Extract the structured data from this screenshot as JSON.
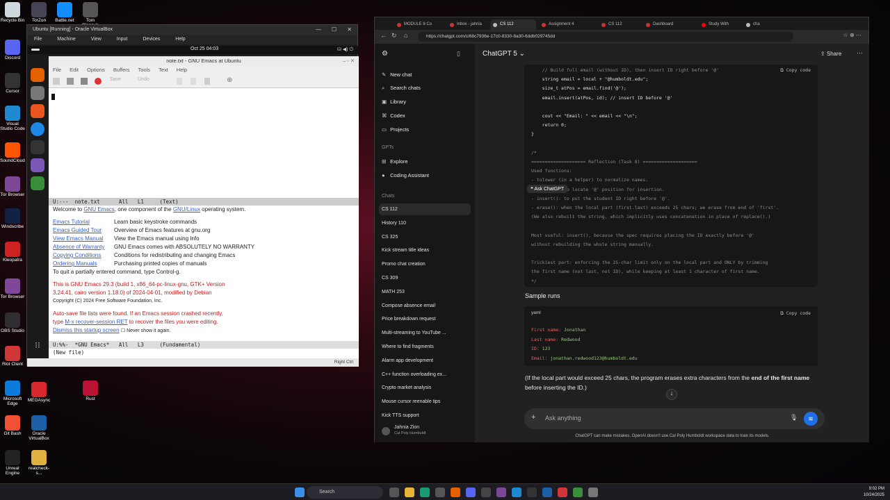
{
  "desktop_icons": [
    {
      "label": "Recycle Bin",
      "color": "#cfd8dc"
    },
    {
      "label": "Discord",
      "color": "#5865f2"
    },
    {
      "label": "Cursor",
      "color": "#333"
    },
    {
      "label": "Visual Studio Code",
      "color": "#1f8ad2"
    },
    {
      "label": "SoundCloud",
      "color": "#ff5500"
    },
    {
      "label": "Tor Browser",
      "color": "#7e4798"
    },
    {
      "label": "Windscribe",
      "color": "#124"
    },
    {
      "label": "Kleopatra",
      "color": "#c22"
    },
    {
      "label": "Tor Browser",
      "color": "#7e4798"
    },
    {
      "label": "OBS Studio",
      "color": "#302e31"
    },
    {
      "label": "Riot Client",
      "color": "#d13639"
    },
    {
      "label": "Microsoft Edge",
      "color": "#0c7bdc"
    },
    {
      "label": "Git Bash",
      "color": "#f05033"
    },
    {
      "label": "Unreal Engine",
      "color": "#222"
    }
  ],
  "desktop_icons2": [
    {
      "label": "TorZon",
      "color": "#445"
    },
    {
      "label": "Battle.net",
      "color": "#148eff"
    },
    {
      "label": "Tom Clancy's",
      "color": "#555"
    },
    {
      "label": "MEGAsync",
      "color": "#d9272e"
    },
    {
      "label": "Oracle VirtualBox",
      "color": "#1d5fa5"
    },
    {
      "label": "realcheck-s...",
      "color": "#e0b040"
    },
    {
      "label": "Rust",
      "color": "#b13"
    }
  ],
  "vbox": {
    "title": "Ubuntu [Running] - Oracle VirtualBox",
    "menu": [
      "File",
      "Machine",
      "View",
      "Input",
      "Devices",
      "Help"
    ],
    "clock": "Oct 25  04:03",
    "status": "Right Ctrl"
  },
  "emacs": {
    "title": "note.txt - GNU Emacs at Ubuntu",
    "menu": [
      "File",
      "Edit",
      "Options",
      "Buffers",
      "Tools",
      "Text",
      "Help"
    ],
    "tool_save": "Save",
    "tool_undo": "Undo",
    "modeline1": "U:---  note.txt      All   L1     (Text)",
    "welcome_pre": "Welcome to ",
    "welcome_link1": "GNU Emacs",
    "welcome_mid": ", one component of the ",
    "welcome_link2": "GNU/Linux",
    "welcome_post": " operating system.",
    "rows": [
      {
        "link": "Emacs Tutorial",
        "text": "Learn basic keystroke commands"
      },
      {
        "link": "Emacs Guided Tour",
        "text": "Overview of Emacs features at gnu.org"
      },
      {
        "link": "View Emacs Manual",
        "text": "View the Emacs manual using Info"
      },
      {
        "link": "Absence of Warranty",
        "text": "GNU Emacs comes with ABSOLUTELY NO WARRANTY"
      },
      {
        "link": "Copying Conditions",
        "text": "Conditions for redistributing and changing Emacs"
      },
      {
        "link": "Ordering Manuals",
        "text": "Purchasing printed copies of manuals"
      }
    ],
    "quit": "To quit a partially entered command, type Control-g.",
    "version1": "This is GNU Emacs 29.3 (build 1, x86_64-pc-linux-gnu, GTK+ Version",
    "version2": " 3.24.41, cairo version 1.18.0) of 2024-04-01, modified by Debian",
    "copyright": "Copyright (C) 2024 Free Software Foundation, Inc.",
    "autosave1": "Auto-save file lists were found.  If an Emacs session crashed recently,",
    "autosave2_pre": "type ",
    "autosave2_link": "M-x recover-session RET",
    "autosave2_post": " to recover the files you were editing.",
    "dismiss": "Dismiss this startup screen",
    "never": "Never show it again.",
    "modeline2": "U:%%-  *GNU Emacs*   All   L3     (Fundamental)",
    "echo": "(New file)"
  },
  "browser": {
    "tabs": [
      {
        "label": "MODULE 8 Co",
        "color": "#c33"
      },
      {
        "label": "Inbox - jahnia",
        "color": "#c33"
      },
      {
        "label": "CS 112",
        "color": "#bbb",
        "active": true
      },
      {
        "label": "Assignment 4",
        "color": "#c33"
      },
      {
        "label": "CS 112",
        "color": "#c33"
      },
      {
        "label": "Dashboard",
        "color": "#c33"
      },
      {
        "label": "Study With",
        "color": "#f00"
      },
      {
        "label": "cha",
        "color": "#bbb"
      }
    ],
    "url": "https://chatgpt.com/c/68c7936e-17c0-8330-8a30-6ddb029745dd"
  },
  "chatgpt": {
    "model": "ChatGPT 5",
    "share": "Share",
    "nav": [
      "New chat",
      "Search chats",
      "Library",
      "Codex",
      "Projects"
    ],
    "gpts_label": "GPTs",
    "gpts": [
      "Explore",
      "Coding Assistant"
    ],
    "chats_label": "Chats",
    "chats": [
      "CS 112",
      "History 110",
      "CS 325",
      "Kick stream title ideas",
      "Promo chat creation",
      "CS 309",
      "MATH 253",
      "Compose absence email",
      "Price breakdown request",
      "Multi-streaming to YouTube ...",
      "Where to find fragments",
      "Alarm app development",
      "C++ function overloading ex...",
      "Crypto market analysis",
      "Mouse cursor reenable tips",
      "Kick TTS support"
    ],
    "user_name": "Jahnia Zion",
    "user_org": "Cal Poly Humboldt",
    "copy_code": "Copy code",
    "ask_chatgpt": "Ask ChatGPT",
    "code_lines": [
      "    // Build full email (without ID), then insert ID right before '@'",
      "    string email = local + \"@humboldt.edu\";",
      "    size_t atPos = email.find('@');",
      "    email.insert(atPos, id); // insert ID before '@'",
      "",
      "    cout << \"Email: \" << email << \"\\n\";",
      "    return 0;",
      "}",
      "",
      "/*",
      "==================== Reflection (Task 8) ====================",
      "Used functions:",
      "- tolower (in a helper) to normalize names.",
      "- find('@') to locate '@' position for insertion.",
      "- insert(): to put the student ID right before '@'.",
      "- erase(): when the local part (first.last) exceeds 25 chars; we erase from end of 'first'.",
      "(We also rebuilt the string, which implicitly uses concatenation in place of replace().)",
      "",
      "Most useful: insert(), because the spec requires placing the ID exactly before '@'",
      "without rebuilding the whole string manually.",
      "",
      "Trickiest part: enforcing the 25-char limit only on the local part and ONLY by trimming",
      "the first name (not last, not ID), while keeping at least 1 character of first name.",
      "*/"
    ],
    "sample_heading": "Sample runs",
    "sample_lang": "yaml",
    "sample": [
      {
        "k": "First name:",
        "v": "Jonathan"
      },
      {
        "k": "Last name:",
        "v": "Redwood"
      },
      {
        "k": "ID:",
        "v": "123"
      },
      {
        "k": "Email:",
        "v": "jonathan.redwood123@humboldt.edu"
      }
    ],
    "note_pre": "(If the local part would exceed 25 chars, the program erases extra characters from the ",
    "note_bold": "end of the first name",
    "note_post": "before inserting the ID.)",
    "composer_placeholder": "Ask anything",
    "disclaimer": "ChatGPT can make mistakes. OpenAI doesn't use Cal Poly Humboldt workspace data to train its models."
  },
  "taskbar": {
    "search": "Search",
    "time": "9:02 PM",
    "date": "10/24/2025"
  }
}
